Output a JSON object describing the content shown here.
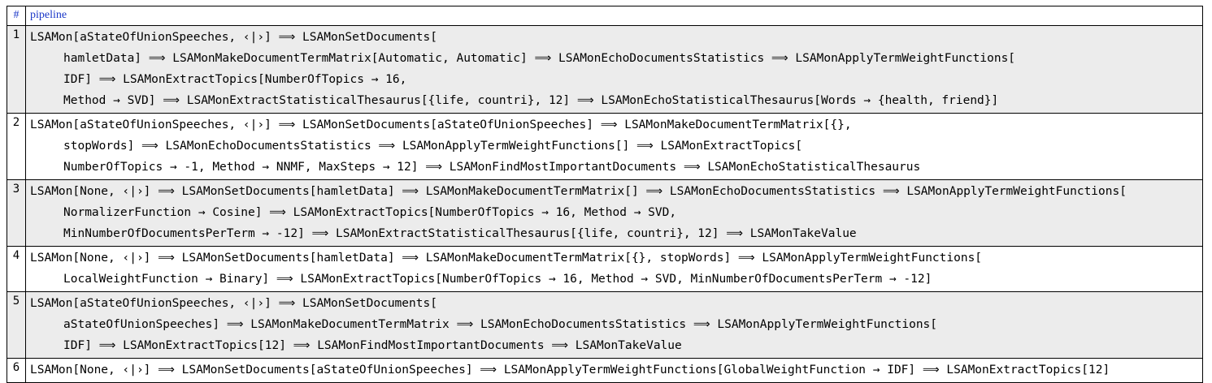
{
  "table": {
    "headers": [
      "#",
      "pipeline"
    ],
    "rows": [
      {
        "num": "1",
        "lines": [
          "LSAMon[aStateOfUnionSpeeches, ‹|›] ⟹ LSAMonSetDocuments[",
          "hamletData] ⟹ LSAMonMakeDocumentTermMatrix[Automatic, Automatic] ⟹ LSAMonEchoDocumentsStatistics ⟹ LSAMonApplyTermWeightFunctions[",
          "IDF] ⟹ LSAMonExtractTopics[NumberOfTopics → 16,",
          "Method → SVD] ⟹ LSAMonExtractStatisticalThesaurus[{life, countri}, 12] ⟹ LSAMonEchoStatisticalThesaurus[Words → {health, friend}]"
        ]
      },
      {
        "num": "2",
        "lines": [
          "LSAMon[aStateOfUnionSpeeches, ‹|›] ⟹ LSAMonSetDocuments[aStateOfUnionSpeeches] ⟹ LSAMonMakeDocumentTermMatrix[{},",
          "stopWords] ⟹ LSAMonEchoDocumentsStatistics ⟹ LSAMonApplyTermWeightFunctions[] ⟹ LSAMonExtractTopics[",
          "NumberOfTopics → -1, Method → NNMF, MaxSteps → 12] ⟹ LSAMonFindMostImportantDocuments ⟹ LSAMonEchoStatisticalThesaurus"
        ]
      },
      {
        "num": "3",
        "lines": [
          "LSAMon[None, ‹|›] ⟹ LSAMonSetDocuments[hamletData] ⟹ LSAMonMakeDocumentTermMatrix[] ⟹ LSAMonEchoDocumentsStatistics ⟹ LSAMonApplyTermWeightFunctions[",
          "NormalizerFunction → Cosine] ⟹ LSAMonExtractTopics[NumberOfTopics → 16, Method → SVD,",
          "MinNumberOfDocumentsPerTerm → -12] ⟹ LSAMonExtractStatisticalThesaurus[{life, countri}, 12] ⟹ LSAMonTakeValue"
        ]
      },
      {
        "num": "4",
        "lines": [
          "LSAMon[None, ‹|›] ⟹ LSAMonSetDocuments[hamletData] ⟹ LSAMonMakeDocumentTermMatrix[{}, stopWords] ⟹ LSAMonApplyTermWeightFunctions[",
          "LocalWeightFunction → Binary] ⟹ LSAMonExtractTopics[NumberOfTopics → 16, Method → SVD, MinNumberOfDocumentsPerTerm → -12]"
        ]
      },
      {
        "num": "5",
        "lines": [
          "LSAMon[aStateOfUnionSpeeches, ‹|›] ⟹ LSAMonSetDocuments[",
          "aStateOfUnionSpeeches] ⟹ LSAMonMakeDocumentTermMatrix ⟹ LSAMonEchoDocumentsStatistics ⟹ LSAMonApplyTermWeightFunctions[",
          "IDF] ⟹ LSAMonExtractTopics[12] ⟹ LSAMonFindMostImportantDocuments ⟹ LSAMonTakeValue"
        ]
      },
      {
        "num": "6",
        "lines": [
          "LSAMon[None, ‹|›] ⟹ LSAMonSetDocuments[aStateOfUnionSpeeches] ⟹ LSAMonApplyTermWeightFunctions[GlobalWeightFunction → IDF] ⟹ LSAMonExtractTopics[12]"
        ]
      }
    ]
  }
}
